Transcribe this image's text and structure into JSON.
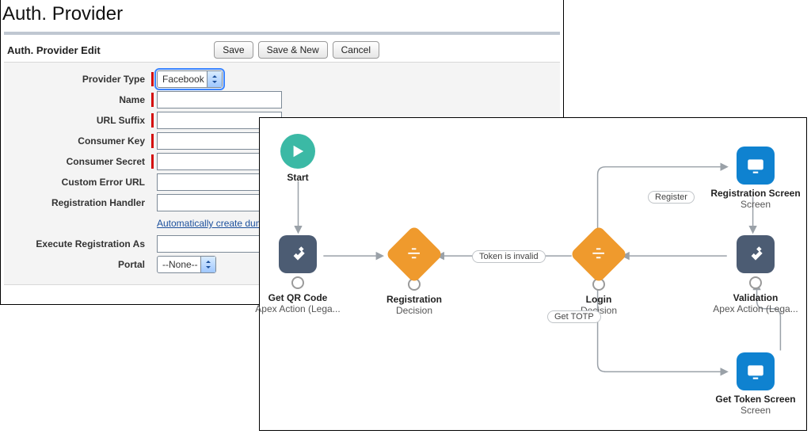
{
  "classic": {
    "page_title": "Auth. Provider",
    "section_title": "Auth. Provider Edit",
    "buttons": {
      "save": "Save",
      "save_new": "Save & New",
      "cancel": "Cancel"
    },
    "fields": {
      "provider_type": {
        "label": "Provider Type",
        "value": "Facebook"
      },
      "name": {
        "label": "Name",
        "value": ""
      },
      "url_suffix": {
        "label": "URL Suffix",
        "value": ""
      },
      "consumer_key": {
        "label": "Consumer Key",
        "value": ""
      },
      "consumer_secret": {
        "label": "Consumer Secret",
        "value": ""
      },
      "custom_error_url": {
        "label": "Custom Error URL",
        "value": ""
      },
      "registration_handler": {
        "label": "Registration Handler",
        "value": ""
      },
      "auto_create_link": "Automatically create dumm",
      "execute_as": {
        "label": "Execute Registration As",
        "value": ""
      },
      "portal": {
        "label": "Portal",
        "value": "--None--"
      }
    }
  },
  "flow": {
    "nodes": {
      "start": {
        "title": "Start"
      },
      "qr": {
        "title": "Get QR Code",
        "subtitle": "Apex Action (Lega..."
      },
      "reg": {
        "title": "Registration",
        "subtitle": "Decision"
      },
      "login": {
        "title": "Login",
        "subtitle": "Decision"
      },
      "valid": {
        "title": "Validation",
        "subtitle": "Apex Action (Lega..."
      },
      "regscr": {
        "title": "Registration Screen",
        "subtitle": "Screen"
      },
      "tokenscr": {
        "title": "Get Token Screen",
        "subtitle": "Screen"
      }
    },
    "edge_labels": {
      "token_invalid": "Token is invalid",
      "register": "Register",
      "get_totp": "Get TOTP"
    }
  }
}
